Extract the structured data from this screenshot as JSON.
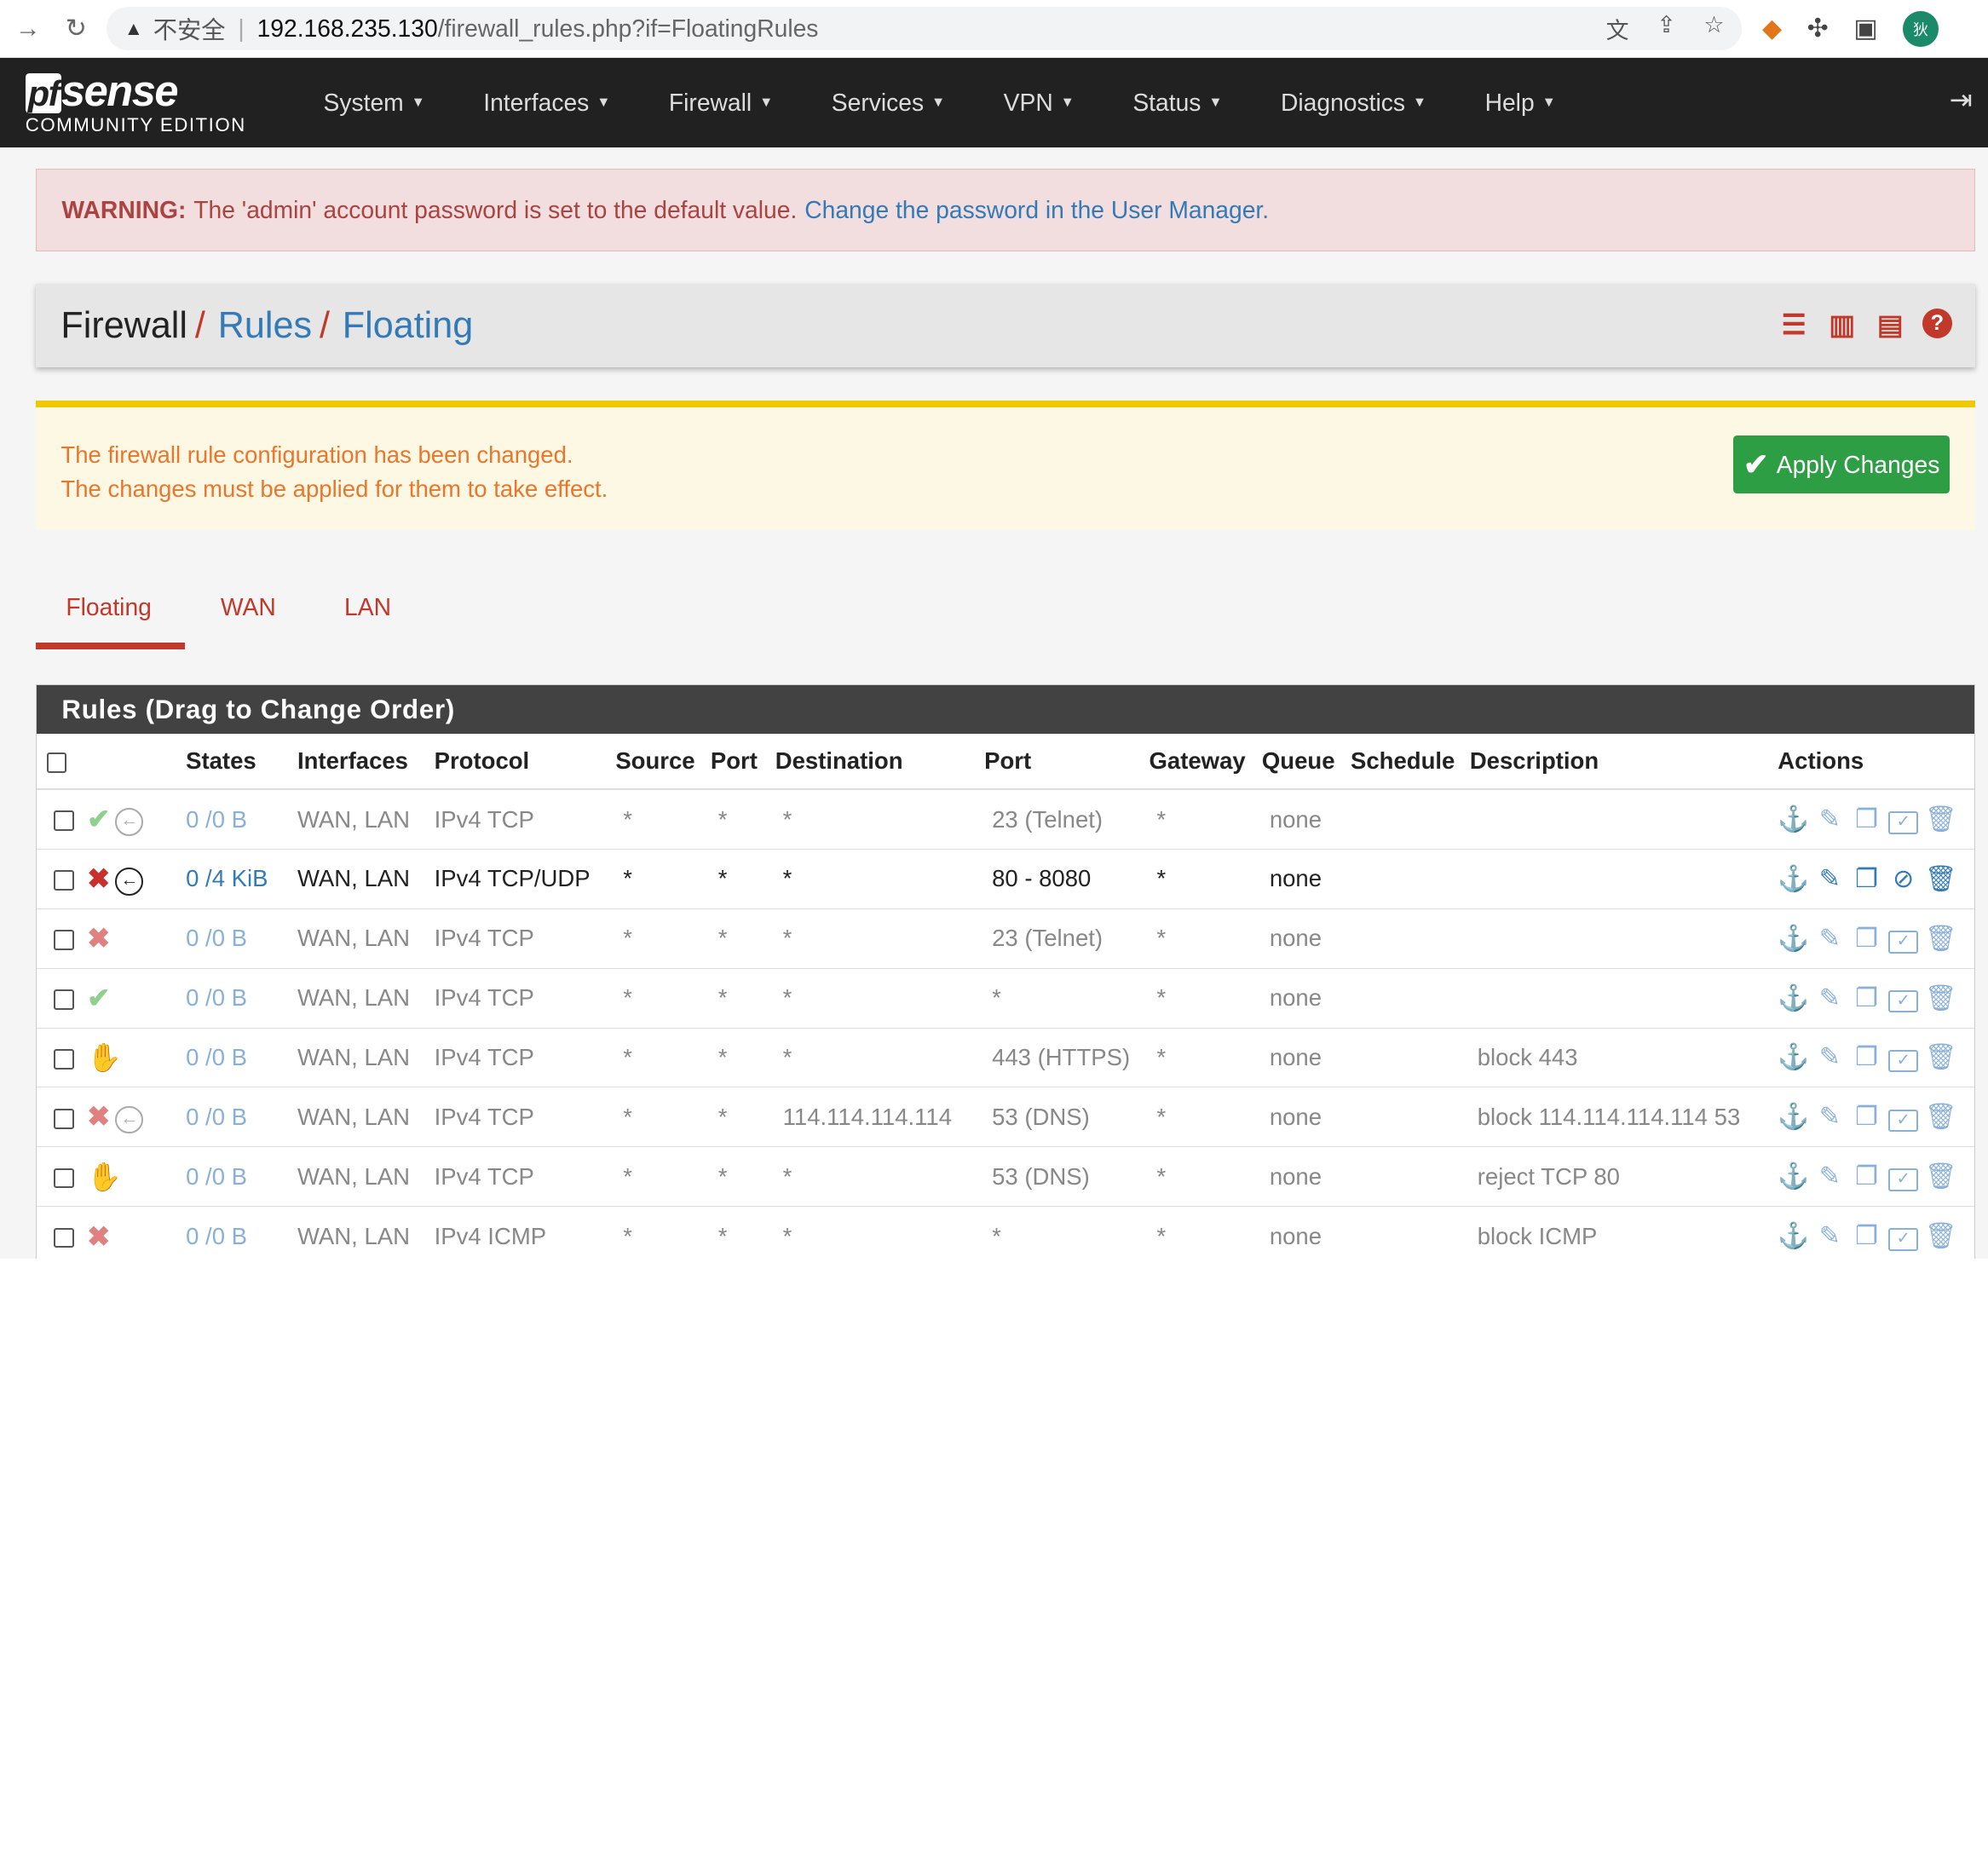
{
  "browser": {
    "warning_symbol": "▲",
    "insecure": "不安全",
    "url_host": "192.168.235.130",
    "url_path": "/firewall_rules.php?if=FloatingRules",
    "avatar": "狄"
  },
  "nav": {
    "brand_pf": "pf",
    "brand_sense": "sense",
    "edition": "COMMUNITY EDITION",
    "menu": [
      "System",
      "Interfaces",
      "Firewall",
      "Services",
      "VPN",
      "Status",
      "Diagnostics",
      "Help"
    ]
  },
  "warning": {
    "label": "WARNING:",
    "text": "The 'admin' account password is set to the default value.",
    "link": "Change the password in the User Manager."
  },
  "breadcrumb": {
    "root": "Firewall",
    "sep": "/",
    "level1": "Rules",
    "level2": "Floating"
  },
  "notice": {
    "line1": "The firewall rule configuration has been changed.",
    "line2": "The changes must be applied for them to take effect.",
    "apply_label": "Apply Changes"
  },
  "tabs": [
    "Floating",
    "WAN",
    "LAN"
  ],
  "rules": {
    "heading": "Rules (Drag to Change Order)",
    "columns": [
      "States",
      "Interfaces",
      "Protocol",
      "Source",
      "Port",
      "Destination",
      "Port",
      "Gateway",
      "Queue",
      "Schedule",
      "Description",
      "Actions"
    ],
    "rows": [
      {
        "action": "pass",
        "enabled": false,
        "dir": true,
        "states": "0 /0 B",
        "interfaces": "WAN, LAN",
        "protocol": "IPv4 TCP",
        "source": "*",
        "sport": "*",
        "dest": "*",
        "dport": "23 (Telnet)",
        "gateway": "*",
        "queue": "none",
        "schedule": "",
        "description": ""
      },
      {
        "action": "block",
        "enabled": true,
        "dir": true,
        "states": "0 /4 KiB",
        "interfaces": "WAN, LAN",
        "protocol": "IPv4 TCP/UDP",
        "source": "*",
        "sport": "*",
        "dest": "*",
        "dport": "80 - 8080",
        "gateway": "*",
        "queue": "none",
        "schedule": "",
        "description": ""
      },
      {
        "action": "block",
        "enabled": false,
        "dir": false,
        "states": "0 /0 B",
        "interfaces": "WAN, LAN",
        "protocol": "IPv4 TCP",
        "source": "*",
        "sport": "*",
        "dest": "*",
        "dport": "23 (Telnet)",
        "gateway": "*",
        "queue": "none",
        "schedule": "",
        "description": ""
      },
      {
        "action": "pass",
        "enabled": false,
        "dir": false,
        "states": "0 /0 B",
        "interfaces": "WAN, LAN",
        "protocol": "IPv4 TCP",
        "source": "*",
        "sport": "*",
        "dest": "*",
        "dport": "*",
        "gateway": "*",
        "queue": "none",
        "schedule": "",
        "description": ""
      },
      {
        "action": "reject",
        "enabled": false,
        "dir": false,
        "states": "0 /0 B",
        "interfaces": "WAN, LAN",
        "protocol": "IPv4 TCP",
        "source": "*",
        "sport": "*",
        "dest": "*",
        "dport": "443 (HTTPS)",
        "gateway": "*",
        "queue": "none",
        "schedule": "",
        "description": "block 443"
      },
      {
        "action": "block",
        "enabled": false,
        "dir": true,
        "states": "0 /0 B",
        "interfaces": "WAN, LAN",
        "protocol": "IPv4 TCP",
        "source": "*",
        "sport": "*",
        "dest": "114.114.114.114",
        "dport": "53 (DNS)",
        "gateway": "*",
        "queue": "none",
        "schedule": "",
        "description": "block 114.114.114.114 53"
      },
      {
        "action": "reject",
        "enabled": false,
        "dir": false,
        "states": "0 /0 B",
        "interfaces": "WAN, LAN",
        "protocol": "IPv4 TCP",
        "source": "*",
        "sport": "*",
        "dest": "*",
        "dport": "53 (DNS)",
        "gateway": "*",
        "queue": "none",
        "schedule": "",
        "description": "reject TCP 80"
      },
      {
        "action": "block",
        "enabled": false,
        "dir": false,
        "states": "0 /0 B",
        "interfaces": "WAN, LAN",
        "protocol": "IPv4 ICMP",
        "source": "*",
        "sport": "*",
        "dest": "*",
        "dport": "*",
        "gateway": "*",
        "queue": "none",
        "schedule": "",
        "description": "block ICMP"
      }
    ]
  },
  "colors": {
    "brand_red": "#c0392b",
    "link_blue": "#337ab7",
    "apply_green": "#2e9e44",
    "notice_orange": "#e8772e"
  }
}
